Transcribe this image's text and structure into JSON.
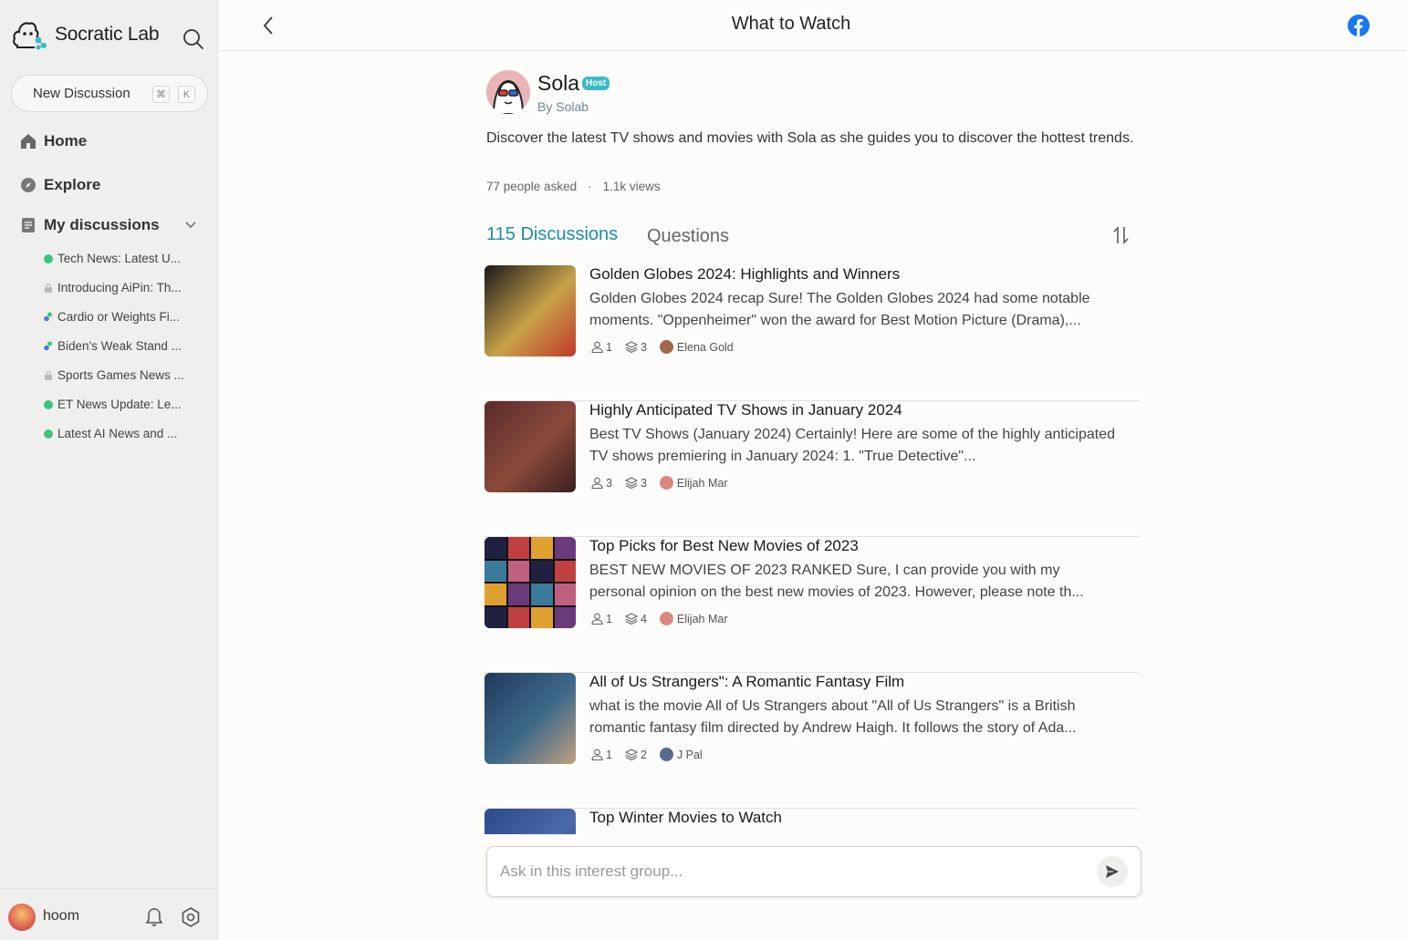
{
  "app": {
    "brand": "Socratic Lab",
    "new_discussion_label": "New Discussion",
    "shortcut_keys": [
      "⌘",
      "K"
    ]
  },
  "sidebar": {
    "nav": [
      {
        "label": "Home",
        "icon": "home-icon"
      },
      {
        "label": "Explore",
        "icon": "compass-icon"
      },
      {
        "label": "My discussions",
        "icon": "document-icon"
      }
    ],
    "discussions": [
      {
        "label": "Tech News: Latest U...",
        "status_color": "#3cc47c"
      },
      {
        "label": "Introducing AiPin: Th...",
        "status_color": "#b9b9b9",
        "locked": true
      },
      {
        "label": "Cardio or Weights Fi...",
        "status_color": "#4a7bd8"
      },
      {
        "label": "Biden's Weak Stand ...",
        "status_color": "#4a7bd8"
      },
      {
        "label": "Sports Games News ...",
        "status_color": "#b9b9b9",
        "locked": true
      },
      {
        "label": "ET News Update: Le...",
        "status_color": "#3cc47c"
      },
      {
        "label": "Latest AI News and ...",
        "status_color": "#3cc47c"
      }
    ],
    "user": {
      "name": "hoom"
    }
  },
  "header": {
    "title": "What to Watch"
  },
  "host": {
    "name": "Sola",
    "badge": "Host",
    "by": "By Solab",
    "description": "Discover the latest TV shows and movies with Sola as she guides you to discover the hottest trends.",
    "people_asked": "77 people asked",
    "separator": "·",
    "views": "1.1k views"
  },
  "tabs": {
    "discussions": "115 Discussions",
    "questions": "Questions"
  },
  "cards": [
    {
      "title": "Golden Globes 2024: Highlights and Winners",
      "body": "Golden Globes 2024 recap Sure! The Golden Globes 2024 had some notable moments. \"Oppenheimer\" won the award for Best Motion Picture (Drama),...",
      "participants": "1",
      "layers": "3",
      "author": "Elena Gold",
      "author_color": "#a0674b",
      "thumb_colors": [
        "#1a1a1a",
        "#c8a24a",
        "#c0392b"
      ]
    },
    {
      "title": "Highly Anticipated TV Shows in January 2024",
      "body": "Best TV Shows (January 2024) Certainly! Here are some of the highly anticipated TV shows premiering in January 2024: 1. \"True Detective\"...",
      "participants": "3",
      "layers": "3",
      "author": "Elijah Mar",
      "author_color": "#d98880",
      "thumb_colors": [
        "#5a2b2b",
        "#8a4a3a",
        "#3a1f1f"
      ]
    },
    {
      "title": "Top Picks for Best New Movies of 2023",
      "body": "BEST NEW MOVIES OF 2023 RANKED Sure, I can provide you with my personal opinion on the best new movies of 2023. However, please note th...",
      "participants": "1",
      "layers": "4",
      "author": "Elijah Mar",
      "author_color": "#d98880",
      "thumb_colors": [
        "#202040",
        "#c04040",
        "#e0a030"
      ]
    },
    {
      "title": "All of Us Strangers\": A Romantic Fantasy Film",
      "body": "what is the movie All of Us Strangers about \"All of Us Strangers\" is a British romantic fantasy film directed by Andrew Haigh. It follows the story of Ada...",
      "participants": "1",
      "layers": "2",
      "author": "J Pal",
      "author_color": "#5a6a8a",
      "thumb_colors": [
        "#1f3a5a",
        "#3f6a8a",
        "#c0a080"
      ]
    },
    {
      "title": "Top Winter Movies to Watch",
      "body": "",
      "participants": "",
      "layers": "",
      "author": "",
      "author_color": "#5a6a8a",
      "thumb_colors": [
        "#2a4a8a",
        "#4a6aaa",
        "#203060"
      ]
    }
  ],
  "ask": {
    "placeholder": "Ask in this interest group..."
  }
}
